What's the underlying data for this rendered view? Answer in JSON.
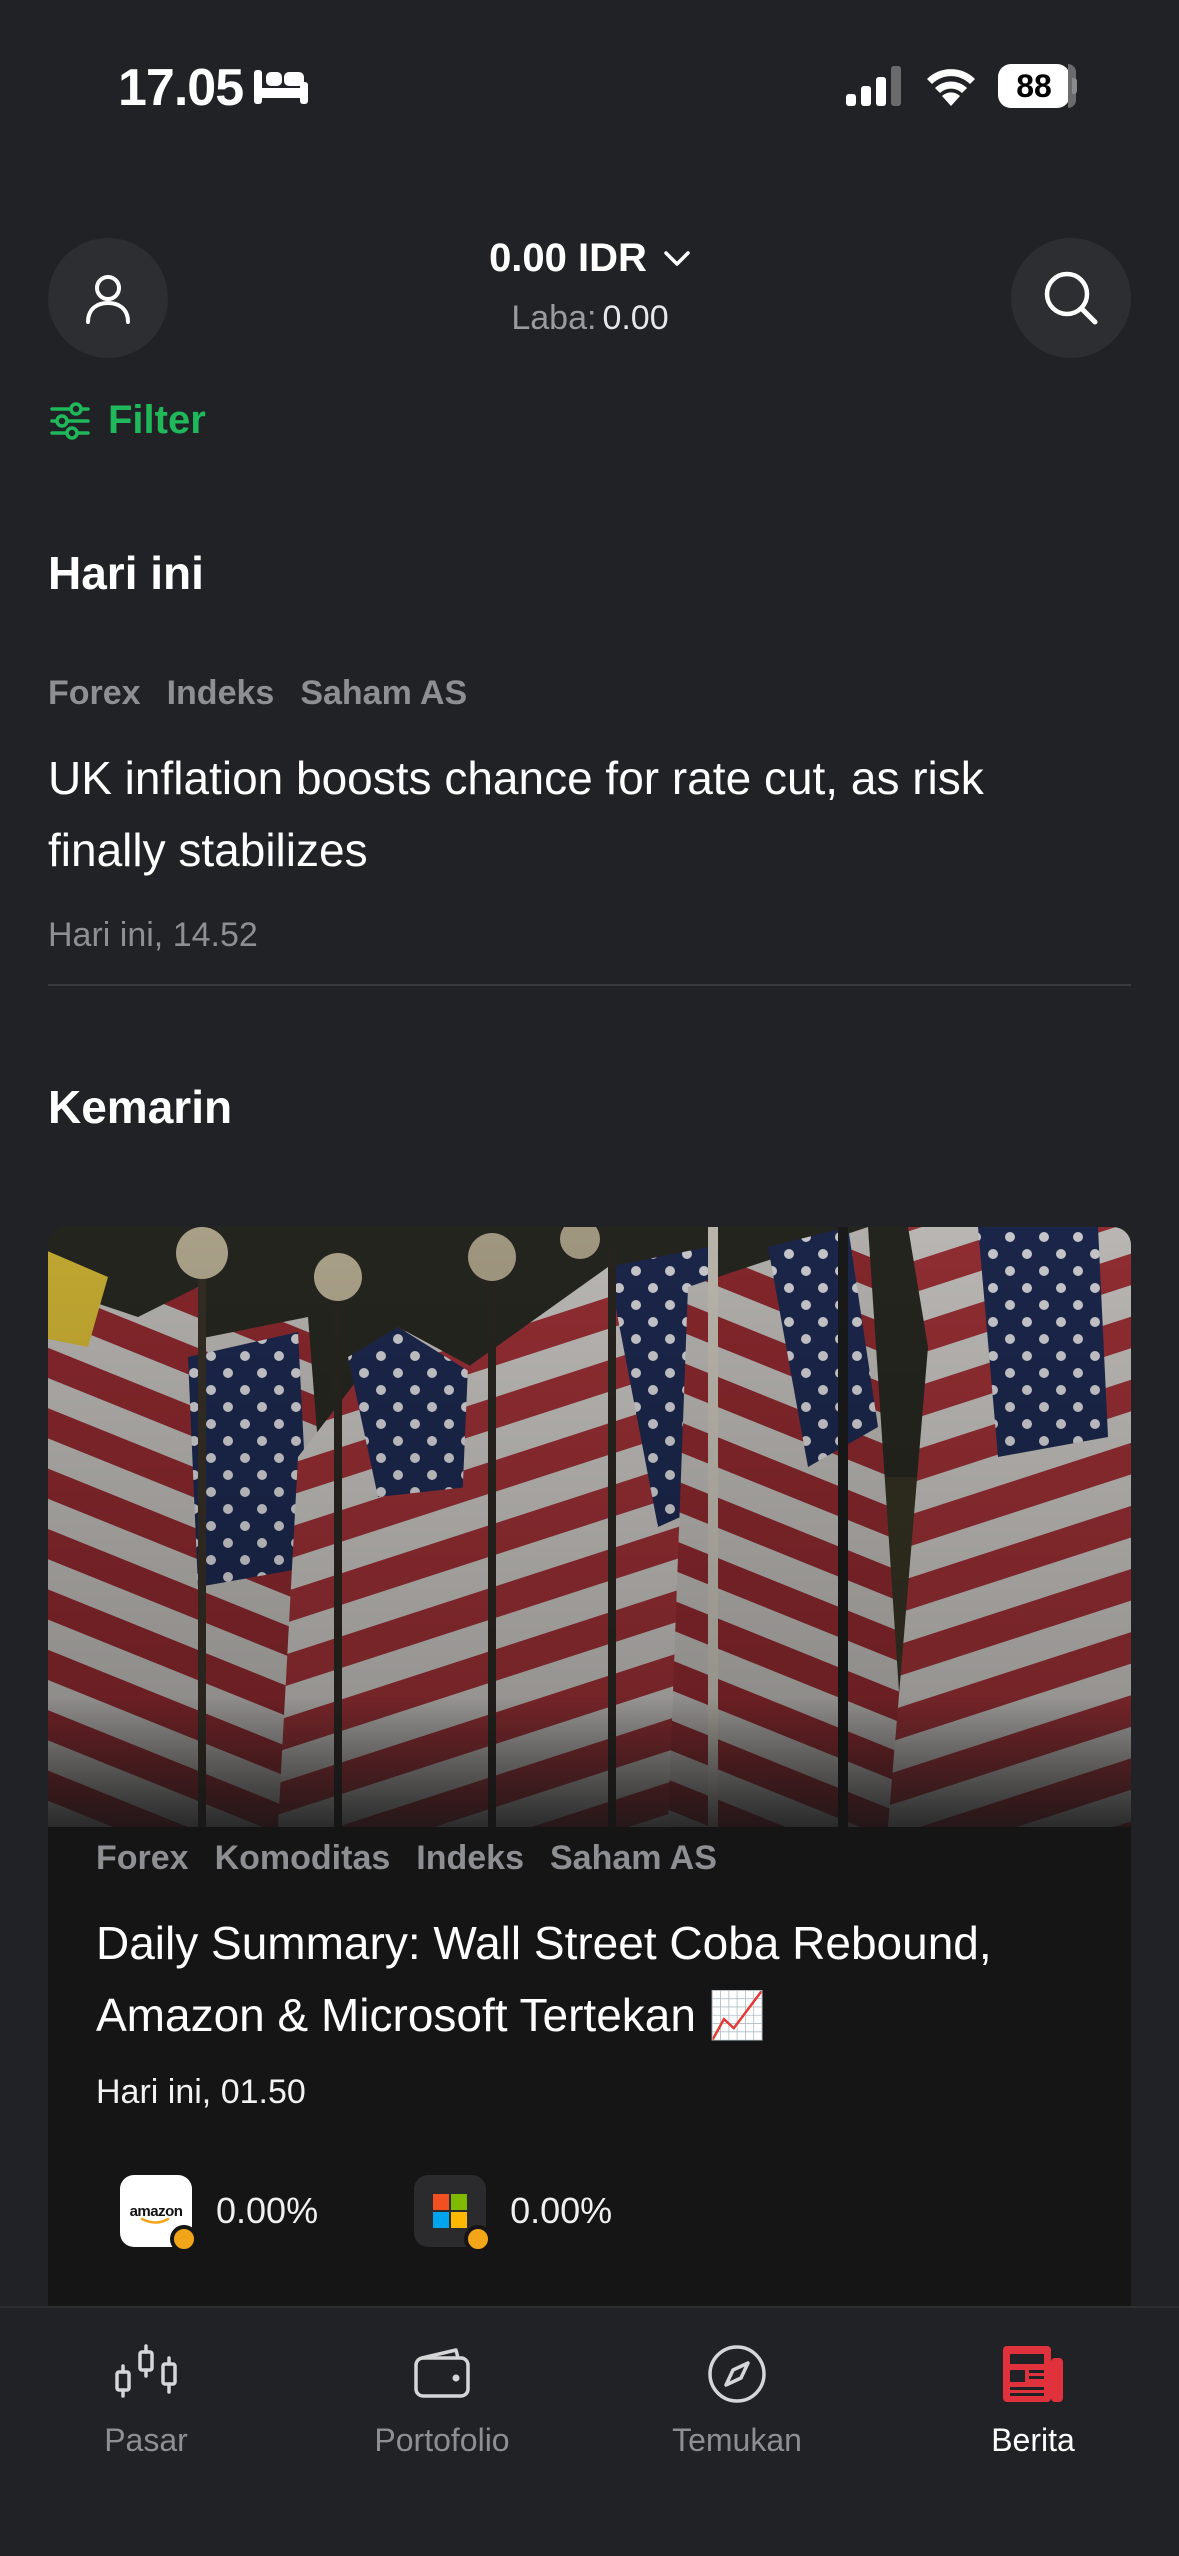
{
  "status_bar": {
    "time": "17.05",
    "battery": "88"
  },
  "header": {
    "balance": "0.00 IDR",
    "profit_label": "Laba:",
    "profit_value": "0.00"
  },
  "filter": {
    "label": "Filter"
  },
  "sections": [
    {
      "title": "Hari ini",
      "articles": [
        {
          "tags": [
            "Forex",
            "Indeks",
            "Saham AS"
          ],
          "headline_line1": "UK inflation boosts chance for rate cut, as risk",
          "headline_line2": "finally stabilizes",
          "time": "Hari ini, 14.52"
        }
      ]
    },
    {
      "title": "Kemarin",
      "articles": [
        {
          "tags": [
            "Forex",
            "Komoditas",
            "Indeks",
            "Saham AS"
          ],
          "headline_line1": "Daily Summary: Wall Street Coba Rebound,",
          "headline_line2": "Amazon & Microsoft Tertekan 📈",
          "time": "Hari ini, 01.50",
          "image": "american-flags-photo",
          "stocks": [
            {
              "logo": "amazon-logo",
              "logo_text": "amazon",
              "change": "0.00%"
            },
            {
              "logo": "microsoft-logo",
              "change": "0.00%"
            }
          ]
        }
      ]
    }
  ],
  "tabs": [
    {
      "label": "Pasar",
      "icon": "candlestick-icon",
      "active": false
    },
    {
      "label": "Portofolio",
      "icon": "wallet-icon",
      "active": false
    },
    {
      "label": "Temukan",
      "icon": "compass-icon",
      "active": false
    },
    {
      "label": "Berita",
      "icon": "newspaper-icon",
      "active": true
    }
  ],
  "colors": {
    "background": "#212225",
    "accent_green": "#1fb85a",
    "active_tab_red": "#e0323c",
    "muted_text": "#8e8f93"
  }
}
